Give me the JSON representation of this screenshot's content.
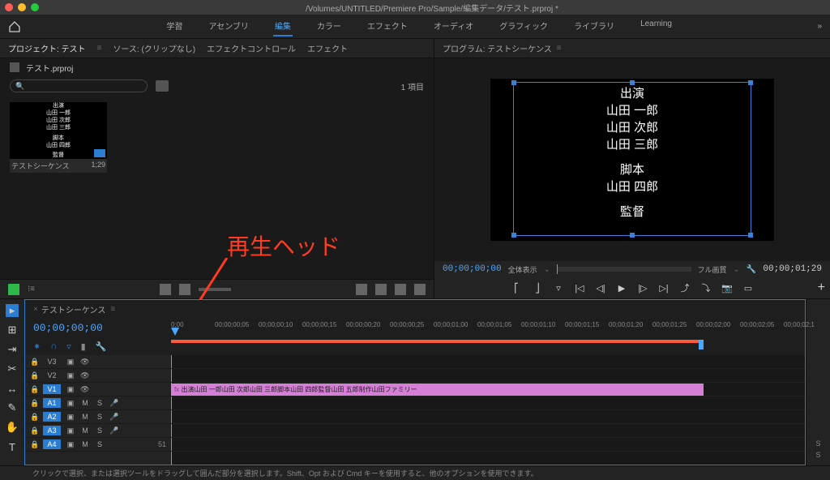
{
  "titlebar": {
    "path": "/Volumes/UNTITLED/Premiere Pro/Sample/編集データ/テスト.prproj *"
  },
  "workspaces": {
    "items": [
      "学習",
      "アセンブリ",
      "編集",
      "カラー",
      "エフェクト",
      "オーディオ",
      "グラフィック",
      "ライブラリ",
      "Learning"
    ],
    "active_index": 2,
    "overflow": "»"
  },
  "project_panel": {
    "tabs": [
      "プロジェクト: テスト",
      "ソース: (クリップなし)",
      "エフェクトコントロール",
      "エフェクト"
    ],
    "active_tab": 0,
    "file_label": "テスト.prproj",
    "search_placeholder": "𝄢",
    "item_count": "1 項目",
    "thumb": {
      "lines": [
        "出演",
        "山田 一郎",
        "山田 次郎",
        "山田 三郎",
        "",
        "脚本",
        "山田 四郎",
        "",
        "監督"
      ],
      "name": "テストシーケンス",
      "duration": "1;29"
    }
  },
  "annotation": {
    "text": "再生ヘッド"
  },
  "program": {
    "title": "プログラム: テストシーケンス",
    "credits": [
      "出演",
      "山田 一郎",
      "山田 次郎",
      "山田 三郎",
      "",
      "脚本",
      "山田 四郎",
      "",
      "監督"
    ],
    "tc_in": "00;00;00;00",
    "fit": "全体表示",
    "quality": "フル画質",
    "tc_out": "00;00;01;29"
  },
  "timeline": {
    "seq_tab": "テストシーケンス",
    "tc": "00;00;00;00",
    "ruler": [
      "0;00",
      "00;00;00;05",
      "00;00;00;10",
      "00;00;00;15",
      "00;00;00;20",
      "00;00;00;25",
      "00;00;01;00",
      "00;00;01;05",
      "00;00;01;10",
      "00;00;01;15",
      "00;00;01;20",
      "00;00;01;25",
      "00;00;02;00",
      "00;00;02;05",
      "00;00;02;1"
    ],
    "tracks_v": [
      "V3",
      "V2",
      "V1"
    ],
    "tracks_a": [
      "A1",
      "A2",
      "A3",
      "A4"
    ],
    "m": "M",
    "s": "S",
    "clip_text": "出演山田 一郎山田 次郎山田 三郎脚本山田 四郎監督山田 五郎制作山田ファミリー",
    "frame_count": "51"
  },
  "hint": "クリックで選択、または選択ツールをドラッグして囲んだ部分を選択します。Shift、Opt および Cmd キーを使用すると、他のオプションを使用できます。",
  "tl_right": {
    "s1": "S",
    "s2": "S"
  }
}
